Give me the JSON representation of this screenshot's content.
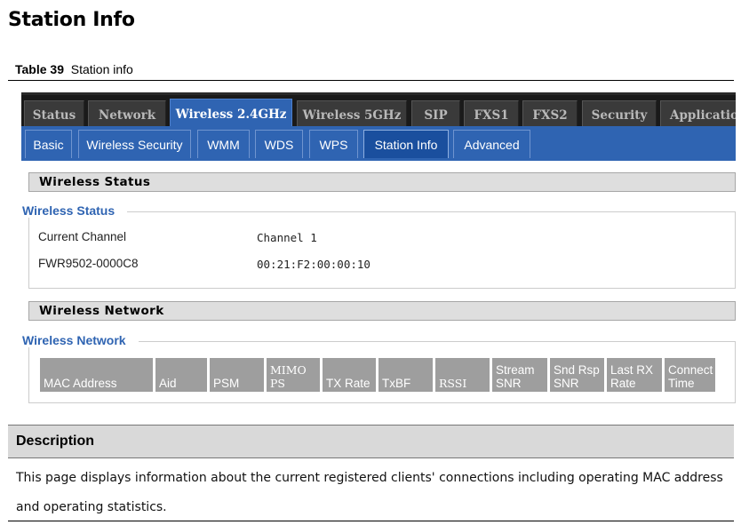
{
  "heading": "Station Info",
  "caption": {
    "number": "Table 39",
    "text": "Station info"
  },
  "main_tabs": [
    "Status",
    "Network",
    "Wireless 2.4GHz",
    "Wireless 5GHz",
    "SIP",
    "FXS1",
    "FXS2",
    "Security",
    "Application"
  ],
  "active_main_tab": "Wireless 2.4GHz",
  "sub_tabs": [
    "Basic",
    "Wireless Security",
    "WMM",
    "WDS",
    "WPS",
    "Station Info",
    "Advanced"
  ],
  "active_sub_tab": "Station Info",
  "wireless_status": {
    "bar_title": "Wireless Status",
    "legend": "Wireless Status",
    "rows": [
      {
        "label": "Current Channel",
        "value": "Channel 1"
      },
      {
        "label": "FWR9502-0000C8",
        "value": "00:21:F2:00:00:10"
      }
    ]
  },
  "wireless_network": {
    "bar_title": "Wireless Network",
    "legend": "Wireless Network",
    "columns": [
      "MAC Address",
      "Aid",
      "PSM",
      "MIMO PS",
      "TX Rate",
      "TxBF",
      "RSSI",
      "Stream SNR",
      "Snd Rsp SNR",
      "Last RX Rate",
      "Connect Time"
    ]
  },
  "description": {
    "title": "Description",
    "text": "This page displays information about the current registered clients' connections including operating MAC address and operating  statistics."
  },
  "colors": {
    "accent": "#2f64b2",
    "tab_bar": "#1a1a1a",
    "header_cell": "#9e9e9e"
  }
}
